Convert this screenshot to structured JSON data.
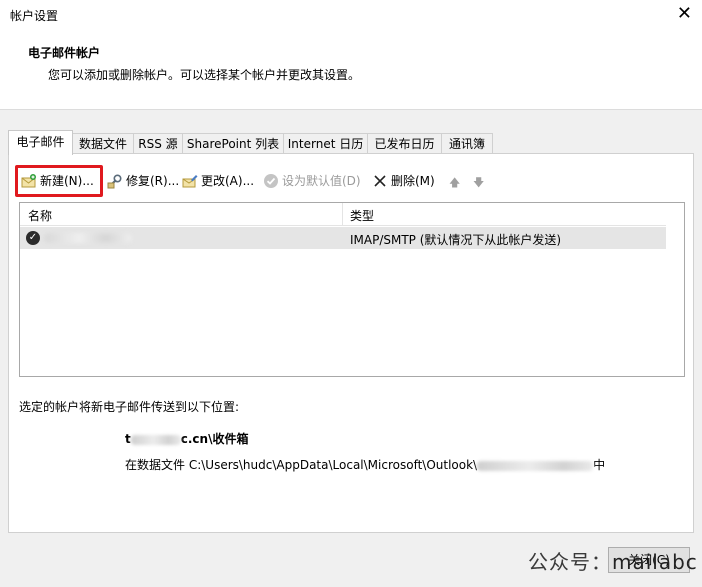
{
  "window": {
    "title": "帐户设置",
    "close_glyph": "✕"
  },
  "header": {
    "heading": "电子邮件帐户",
    "description": "您可以添加或删除帐户。可以选择某个帐户并更改其设置。"
  },
  "tabs": [
    {
      "label": "电子邮件",
      "active": true
    },
    {
      "label": "数据文件",
      "active": false
    },
    {
      "label": "RSS 源",
      "active": false
    },
    {
      "label": "SharePoint 列表",
      "active": false
    },
    {
      "label": "Internet 日历",
      "active": false
    },
    {
      "label": "已发布日历",
      "active": false
    },
    {
      "label": "通讯簿",
      "active": false
    }
  ],
  "toolbar": {
    "new_label": "新建(N)...",
    "repair_label": "修复(R)...",
    "change_label": "更改(A)...",
    "set_default_label": "设为默认值(D)",
    "remove_label": "删除(M)",
    "move_up_glyph": "🡅",
    "move_down_glyph": "🡇"
  },
  "account_list": {
    "columns": [
      "名称",
      "类型"
    ],
    "rows": [
      {
        "name": "",
        "type": "IMAP/SMTP (默认情况下从此帐户发送)"
      }
    ]
  },
  "delivery": {
    "label": "选定的帐户将新电子邮件传送到以下位置:",
    "folder_prefix": "t",
    "folder_suffix": "c.cn\\收件箱",
    "path_prefix": "在数据文件 C:\\Users\\hudc\\AppData\\Local\\Microsoft\\Outlook\\",
    "path_suffix": "中"
  },
  "footer": {
    "close_label": "关闭(C)"
  },
  "watermark": {
    "prefix": "公众号：",
    "account": "mailabc"
  },
  "colors": {
    "highlight": "#e0191e",
    "selected_row": "#e5e5e5"
  }
}
